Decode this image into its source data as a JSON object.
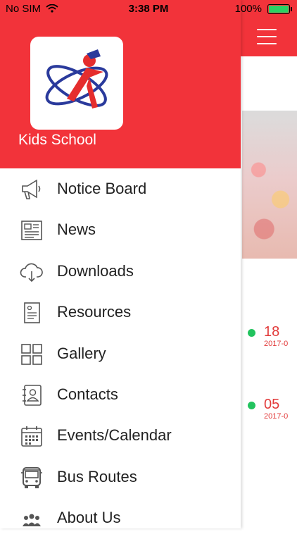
{
  "status_bar": {
    "carrier": "No SIM",
    "time": "3:38 PM",
    "battery_percent": "100%"
  },
  "drawer": {
    "school_name": "Kids School",
    "menu_items": [
      {
        "label": "Notice Board",
        "icon": "megaphone-icon"
      },
      {
        "label": "News",
        "icon": "newspaper-icon"
      },
      {
        "label": "Downloads",
        "icon": "cloud-download-icon"
      },
      {
        "label": "Resources",
        "icon": "document-icon"
      },
      {
        "label": "Gallery",
        "icon": "grid-icon"
      },
      {
        "label": "Contacts",
        "icon": "address-book-icon"
      },
      {
        "label": "Events/Calendar",
        "icon": "calendar-icon"
      },
      {
        "label": "Bus Routes",
        "icon": "bus-icon"
      },
      {
        "label": "About Us",
        "icon": "group-icon"
      }
    ]
  },
  "background": {
    "events": [
      {
        "day": "18",
        "date": "2017-0"
      },
      {
        "day": "05",
        "date": "2017-0"
      }
    ]
  },
  "colors": {
    "accent": "#f2333a",
    "event_dot": "#22c35e",
    "event_text": "#e23b3b"
  }
}
